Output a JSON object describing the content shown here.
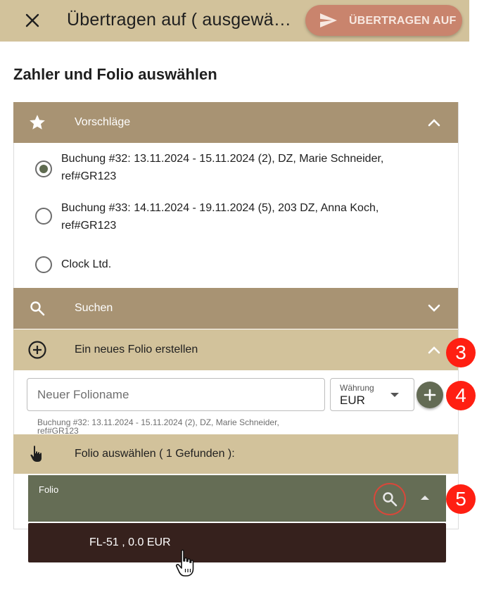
{
  "header": {
    "close_icon": "close-icon",
    "title": "Übertragen auf ( ausgewä…",
    "transfer_button": "ÜBERTRAGEN AUF"
  },
  "page_title": "Zahler und Folio auswählen",
  "sections": {
    "suggestions": {
      "icon": "star-icon",
      "label": "Vorschläge",
      "expanded": true
    },
    "search": {
      "icon": "search-icon",
      "label": "Suchen",
      "expanded": false
    },
    "new_folio": {
      "icon": "add-circle-icon",
      "label": "Ein neues Folio erstellen",
      "expanded": true
    },
    "select_folio": {
      "icon": "hand-pointer-icon",
      "label": "Folio auswählen ( 1 Gefunden ):"
    }
  },
  "suggestions": [
    {
      "label": "Buchung #32: 13.11.2024 - 15.11.2024 (2), DZ, Marie Schneider, ref#GR123",
      "selected": true
    },
    {
      "label": "Buchung #33: 14.11.2024 - 19.11.2024 (5), 203 DZ, Anna Koch, ref#GR123",
      "selected": false
    },
    {
      "label": "Clock Ltd.",
      "selected": false
    }
  ],
  "new_folio_form": {
    "name_placeholder": "Neuer Folioname",
    "currency_label": "Währung",
    "currency_value": "EUR",
    "hint": "Buchung #32: 13.11.2024 - 15.11.2024 (2), DZ, Marie Schneider, ref#GR123"
  },
  "folio_select": {
    "label": "Folio",
    "options": [
      "FL-51 , 0.0 EUR"
    ]
  },
  "step_badges": [
    "3",
    "4",
    "5"
  ],
  "colors": {
    "header_bg": "#d2c29b",
    "section_dark": "#a89373",
    "section_light": "#d2c29b",
    "transfer_button": "#c9846d",
    "folio_field": "#656d55",
    "dropdown_option": "#36211d",
    "badge": "#ff1f12"
  }
}
